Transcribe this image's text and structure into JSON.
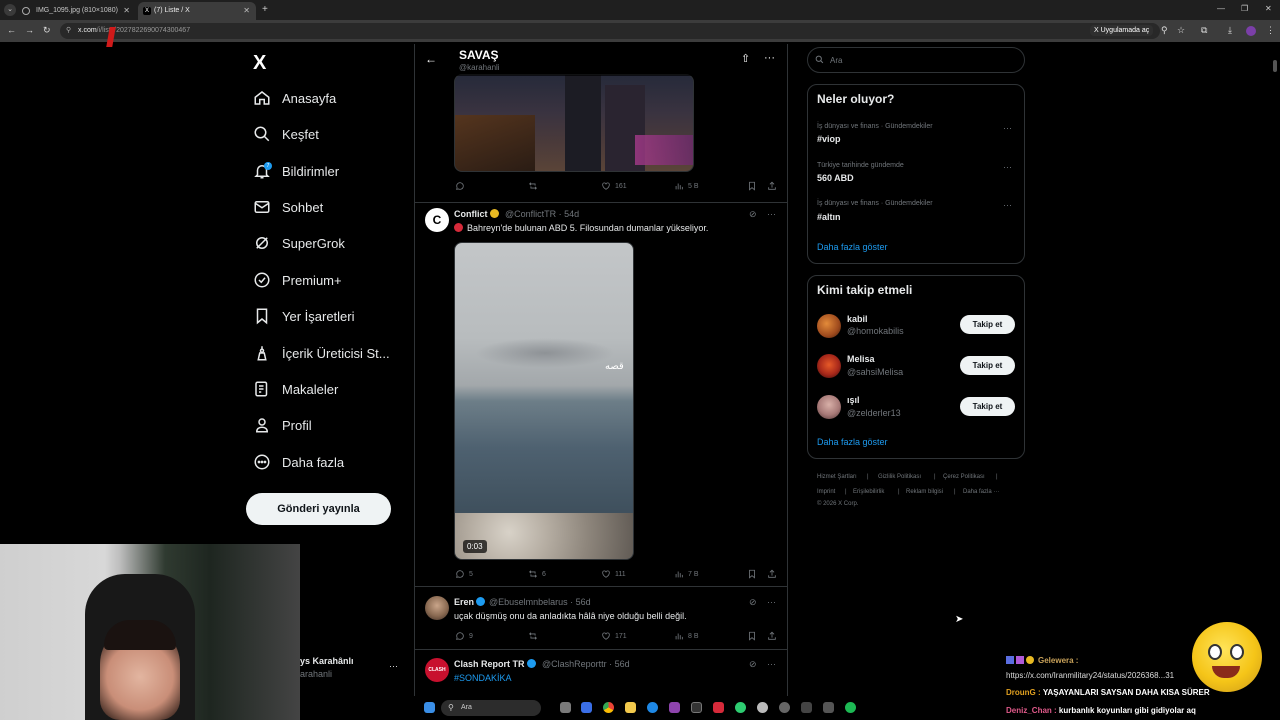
{
  "browser": {
    "tabs": [
      {
        "label": "IMG_1095.jpg (810×1080)"
      },
      {
        "label": "(7) Liste / X"
      }
    ],
    "url_domain": "x.com",
    "url_path": "/i/lists/2027822690074300467",
    "app_button": "Uygulamada aç"
  },
  "sidebar": {
    "logo": "X",
    "items": [
      {
        "label": "Anasayfa",
        "icon": "home-icon"
      },
      {
        "label": "Keşfet",
        "icon": "search-icon"
      },
      {
        "label": "Bildirimler",
        "icon": "bell-icon",
        "badge": "7"
      },
      {
        "label": "Sohbet",
        "icon": "mail-icon"
      },
      {
        "label": "SuperGrok",
        "icon": "grok-icon"
      },
      {
        "label": "Premium+",
        "icon": "verified-icon"
      },
      {
        "label": "Yer İşaretleri",
        "icon": "bookmark-icon"
      },
      {
        "label": "İçerik Üreticisi St...",
        "icon": "creator-icon"
      },
      {
        "label": "Makaleler",
        "icon": "article-icon"
      },
      {
        "label": "Profil",
        "icon": "person-icon"
      },
      {
        "label": "Daha fazla",
        "icon": "more-circle-icon"
      }
    ],
    "post_button": "Gönderi yayınla",
    "account_name": "ys Karahânlı",
    "account_handle": "arahanli"
  },
  "list_header": {
    "title": "SAVAŞ",
    "handle": "@karahanli"
  },
  "tweets": [
    {
      "id": "t0",
      "stats": {
        "reply": "",
        "repost": "",
        "like": "161",
        "views": "5 B"
      }
    },
    {
      "id": "t1",
      "name": "Conflict",
      "handle": "@ConflictTR · 54d",
      "text": "Bahreyn'de bulunan ABD 5. Filosundan dumanlar yükseliyor.",
      "video_duration": "0:03",
      "watermark": "قصه",
      "stats": {
        "reply": "5",
        "repost": "6",
        "like": "111",
        "views": "7 B"
      }
    },
    {
      "id": "t2",
      "name": "Eren",
      "handle": "@Ebuselmnbelarus · 56d",
      "text": "uçak düşmüş onu da anladıkta hâlâ niye olduğu belli değil.",
      "stats": {
        "reply": "9",
        "repost": "",
        "like": "171",
        "views": "8 B"
      }
    },
    {
      "id": "t3",
      "name": "Clash Report TR",
      "handle": "@ClashReporttr · 56d",
      "text": "#SONDAKİKA"
    }
  ],
  "right": {
    "search_placeholder": "Ara",
    "trends_title": "Neler oluyor?",
    "trends": [
      {
        "meta": "İş dünyası ve finans · Gündemdekiler",
        "name": "#viop"
      },
      {
        "meta": "Türkiye tarihinde gündemde",
        "name": "560 ABD"
      },
      {
        "meta": "İş dünyası ve finans · Gündemdekiler",
        "name": "#altın"
      }
    ],
    "trends_more": "Daha fazla göster",
    "who_title": "Kimi takip etmeli",
    "who": [
      {
        "name": "kabil",
        "handle": "@homokabilis",
        "button": "Takip et"
      },
      {
        "name": "Melisa",
        "handle": "@sahsiMelisa",
        "button": "Takip et"
      },
      {
        "name": "ışıl",
        "handle": "@zelderler13",
        "button": "Takip et"
      }
    ],
    "who_more": "Daha fazla göster",
    "footer": [
      "Hizmet Şartları",
      "|",
      "Gizlilik Politikası",
      "|",
      "Çerez Politikası",
      "|",
      "Imprint",
      "|",
      "Erişilebilirlik",
      "|",
      "Reklam bilgisi",
      "|",
      "Daha fazla ···",
      "© 2026 X Corp."
    ]
  },
  "chat": [
    {
      "user": "Gelewera :",
      "msg": "",
      "color": "#c9a25a"
    },
    {
      "user": "",
      "msg": "https://x.com/Iranmilitary24/status/2026368...31",
      "color": "#dddddd"
    },
    {
      "user": "DrounG :",
      "msg": "YAŞAYANLARI SAYSAN DAHA KISA SÜRER",
      "color": "#e0a020"
    },
    {
      "user": "Deniz_Chan :",
      "msg": "kurbanlık koyunları gibi gidiyolar aq",
      "color": "#e05a8a"
    }
  ],
  "taskbar": {
    "search": "Ara"
  },
  "colors": {
    "accent": "#1d9bf0",
    "border": "#2f3336",
    "muted": "#71767b"
  }
}
